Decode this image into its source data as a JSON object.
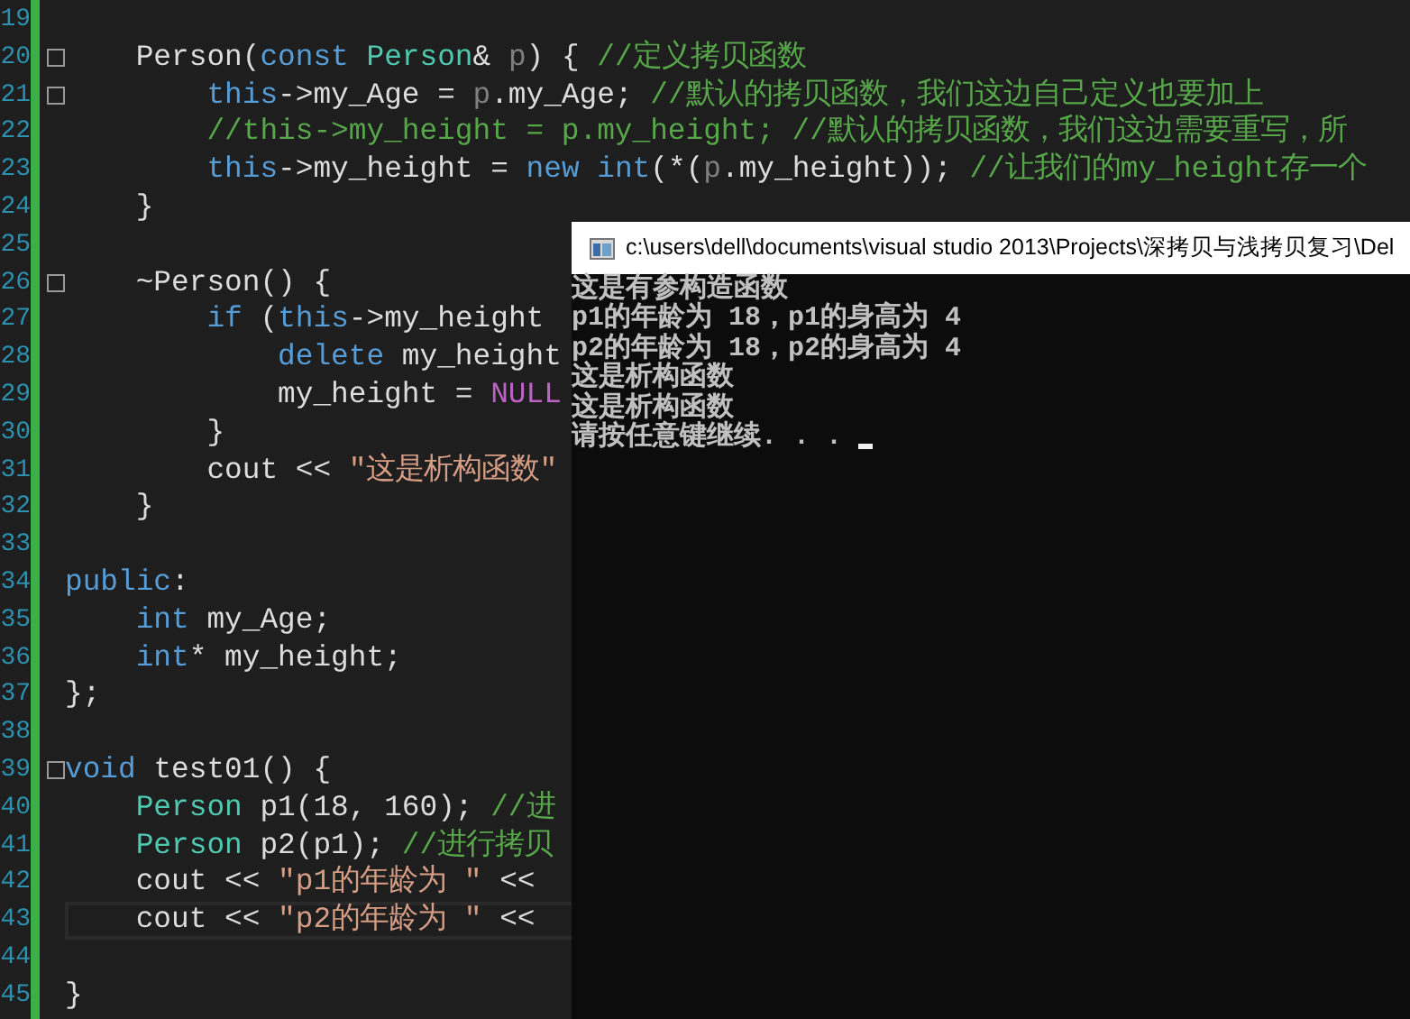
{
  "editor": {
    "lines": [
      {
        "number": "19",
        "foldable": false,
        "current": false
      },
      {
        "number": "20",
        "foldable": true,
        "current": false,
        "tokens": [
          {
            "kind": "plain",
            "text": "    Person("
          },
          {
            "kind": "keyword",
            "text": "const"
          },
          {
            "kind": "type",
            "text": " Person"
          },
          {
            "kind": "plain",
            "text": "& "
          },
          {
            "kind": "param",
            "text": "p"
          },
          {
            "kind": "plain",
            "text": ") { "
          },
          {
            "kind": "comment",
            "text": "//定义拷贝函数"
          }
        ]
      },
      {
        "number": "21",
        "foldable": true,
        "current": false,
        "tokens": [
          {
            "kind": "keyword",
            "text": "        this"
          },
          {
            "kind": "plain",
            "text": "->my_Age = "
          },
          {
            "kind": "param",
            "text": "p"
          },
          {
            "kind": "plain",
            "text": ".my_Age; "
          },
          {
            "kind": "comment",
            "text": "//默认的拷贝函数，我们这边自己定义也要加上"
          }
        ]
      },
      {
        "number": "22",
        "foldable": false,
        "current": false,
        "tokens": [
          {
            "kind": "comment",
            "text": "        //this->my_height = p.my_height; //默认的拷贝函数，我们这边需要重写，所"
          }
        ]
      },
      {
        "number": "23",
        "foldable": false,
        "current": false,
        "tokens": [
          {
            "kind": "keyword",
            "text": "        this"
          },
          {
            "kind": "plain",
            "text": "->my_height = "
          },
          {
            "kind": "keyword",
            "text": "new"
          },
          {
            "kind": "keyword",
            "text": " int"
          },
          {
            "kind": "plain",
            "text": "(*("
          },
          {
            "kind": "param",
            "text": "p"
          },
          {
            "kind": "plain",
            "text": ".my_height)); "
          },
          {
            "kind": "comment",
            "text": "//让我们的my_height存一个"
          }
        ]
      },
      {
        "number": "24",
        "foldable": false,
        "current": false,
        "tokens": [
          {
            "kind": "plain",
            "text": "    }"
          }
        ]
      },
      {
        "number": "25",
        "foldable": false,
        "current": false
      },
      {
        "number": "26",
        "foldable": true,
        "current": false,
        "tokens": [
          {
            "kind": "plain",
            "text": "    ~Person() {"
          }
        ]
      },
      {
        "number": "27",
        "foldable": false,
        "current": false,
        "tokens": [
          {
            "kind": "keyword",
            "text": "        if"
          },
          {
            "kind": "plain",
            "text": " ("
          },
          {
            "kind": "keyword",
            "text": "this"
          },
          {
            "kind": "plain",
            "text": "->my_height"
          }
        ]
      },
      {
        "number": "28",
        "foldable": false,
        "current": false,
        "tokens": [
          {
            "kind": "keyword",
            "text": "            delete"
          },
          {
            "kind": "plain",
            "text": " my_height"
          }
        ]
      },
      {
        "number": "29",
        "foldable": false,
        "current": false,
        "tokens": [
          {
            "kind": "plain",
            "text": "            my_height = "
          },
          {
            "kind": "macro",
            "text": "NULL"
          }
        ]
      },
      {
        "number": "30",
        "foldable": false,
        "current": false,
        "tokens": [
          {
            "kind": "plain",
            "text": "        }"
          }
        ]
      },
      {
        "number": "31",
        "foldable": false,
        "current": false,
        "tokens": [
          {
            "kind": "plain",
            "text": "        cout << "
          },
          {
            "kind": "string",
            "text": "\"这是析构函数\""
          }
        ]
      },
      {
        "number": "32",
        "foldable": false,
        "current": false,
        "tokens": [
          {
            "kind": "plain",
            "text": "    }"
          }
        ]
      },
      {
        "number": "33",
        "foldable": false,
        "current": false
      },
      {
        "number": "34",
        "foldable": false,
        "current": false,
        "tokens": [
          {
            "kind": "keyword",
            "text": "public"
          },
          {
            "kind": "plain",
            "text": ":"
          }
        ]
      },
      {
        "number": "35",
        "foldable": false,
        "current": false,
        "tokens": [
          {
            "kind": "keyword",
            "text": "    int"
          },
          {
            "kind": "plain",
            "text": " my_Age;"
          }
        ]
      },
      {
        "number": "36",
        "foldable": false,
        "current": false,
        "tokens": [
          {
            "kind": "keyword",
            "text": "    int"
          },
          {
            "kind": "plain",
            "text": "* my_height;"
          }
        ]
      },
      {
        "number": "37",
        "foldable": false,
        "current": false,
        "tokens": [
          {
            "kind": "plain",
            "text": "};"
          }
        ]
      },
      {
        "number": "38",
        "foldable": false,
        "current": false
      },
      {
        "number": "39",
        "foldable": true,
        "current": false,
        "tokens": [
          {
            "kind": "keyword",
            "text": "void"
          },
          {
            "kind": "plain",
            "text": " test01() {"
          }
        ]
      },
      {
        "number": "40",
        "foldable": false,
        "current": false,
        "tokens": [
          {
            "kind": "type",
            "text": "    Person"
          },
          {
            "kind": "plain",
            "text": " p1(18, 160); "
          },
          {
            "kind": "comment",
            "text": "//进"
          }
        ]
      },
      {
        "number": "41",
        "foldable": false,
        "current": false,
        "tokens": [
          {
            "kind": "type",
            "text": "    Person"
          },
          {
            "kind": "plain",
            "text": " p2(p1); "
          },
          {
            "kind": "comment",
            "text": "//进行拷贝"
          }
        ]
      },
      {
        "number": "42",
        "foldable": false,
        "current": false,
        "tokens": [
          {
            "kind": "plain",
            "text": "    cout << "
          },
          {
            "kind": "string",
            "text": "\"p1的年龄为 \""
          },
          {
            "kind": "plain",
            "text": " <<"
          }
        ]
      },
      {
        "number": "43",
        "foldable": false,
        "current": true,
        "tokens": [
          {
            "kind": "plain",
            "text": "    cout << "
          },
          {
            "kind": "string",
            "text": "\"p2的年龄为 \""
          },
          {
            "kind": "plain",
            "text": " <<"
          }
        ]
      },
      {
        "number": "44",
        "foldable": false,
        "current": false
      },
      {
        "number": "45",
        "foldable": false,
        "current": false,
        "tokens": [
          {
            "kind": "plain",
            "text": "}"
          }
        ]
      }
    ]
  },
  "console": {
    "title": "c:\\users\\dell\\documents\\visual studio 2013\\Projects\\深拷贝与浅拷贝复习\\Del",
    "lines": [
      "这是有参构造函数",
      "p1的年龄为 18，p1的身高为 4",
      "p2的年龄为 18，p2的身高为 4",
      "这是析构函数",
      "这是析构函数",
      "请按任意键继续. . . "
    ]
  }
}
